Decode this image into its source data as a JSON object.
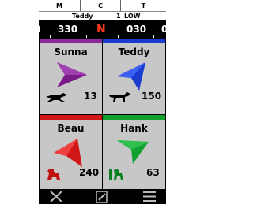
{
  "topbar": {
    "left": "M",
    "center": "C",
    "right": "T"
  },
  "namerow": {
    "name": "Teddy",
    "count": "1",
    "status": "LOW"
  },
  "compass": {
    "left_partial": "0",
    "heading_left": "330",
    "north": "N",
    "heading_right": "030",
    "right_partial": "0"
  },
  "dogs": [
    {
      "name": "Sunna",
      "distance": "13",
      "color": "#7a1a8a",
      "bar_color": "#8a2a9a",
      "icon": "running-dog-icon"
    },
    {
      "name": "Teddy",
      "distance": "150",
      "color": "#1a3ad0",
      "bar_color": "#1a3ad0",
      "icon": "pointing-dog-icon"
    },
    {
      "name": "Beau",
      "distance": "240",
      "color": "#d01818",
      "bar_color": "#d01818",
      "icon": "sitting-dog-icon"
    },
    {
      "name": "Hank",
      "distance": "63",
      "color": "#12a030",
      "bar_color": "#12a030",
      "icon": "treed-dog-icon"
    }
  ],
  "bottombar": {
    "left_icon": "close-icon",
    "center_icon": "edit-page-icon",
    "right_icon": "menu-icon"
  }
}
